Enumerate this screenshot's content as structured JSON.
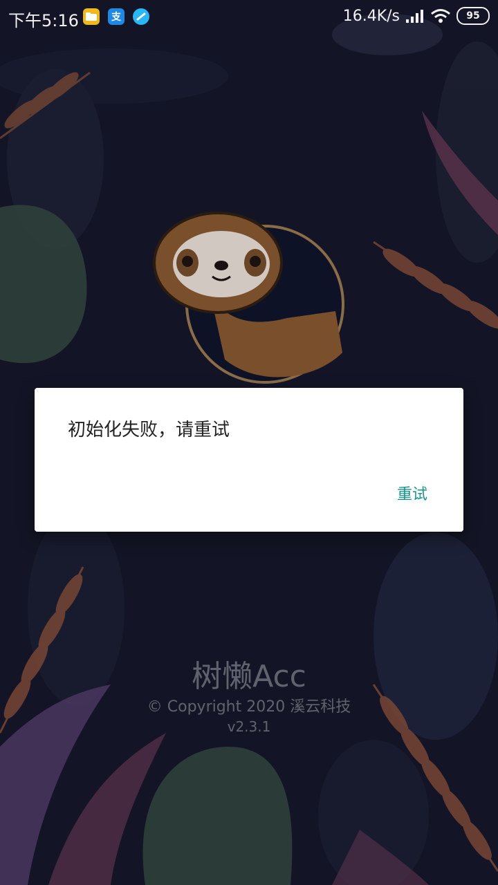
{
  "status_bar": {
    "time": "下午5:16",
    "network_speed": "16.4K/s",
    "battery": "95",
    "app_icons": [
      "folder-app-icon",
      "alipay-icon",
      "browser-app-icon"
    ],
    "alipay_glyph": "支"
  },
  "splash": {
    "app_name": "树懒Acc",
    "copyright": "© Copyright 2020 溪云科技",
    "version": "v2.3.1"
  },
  "dialog": {
    "message": "初始化失败，请重试",
    "retry_label": "重试"
  },
  "colors": {
    "background": "#171a2c",
    "accent": "#16968d",
    "dialog_bg": "#ffffff"
  }
}
